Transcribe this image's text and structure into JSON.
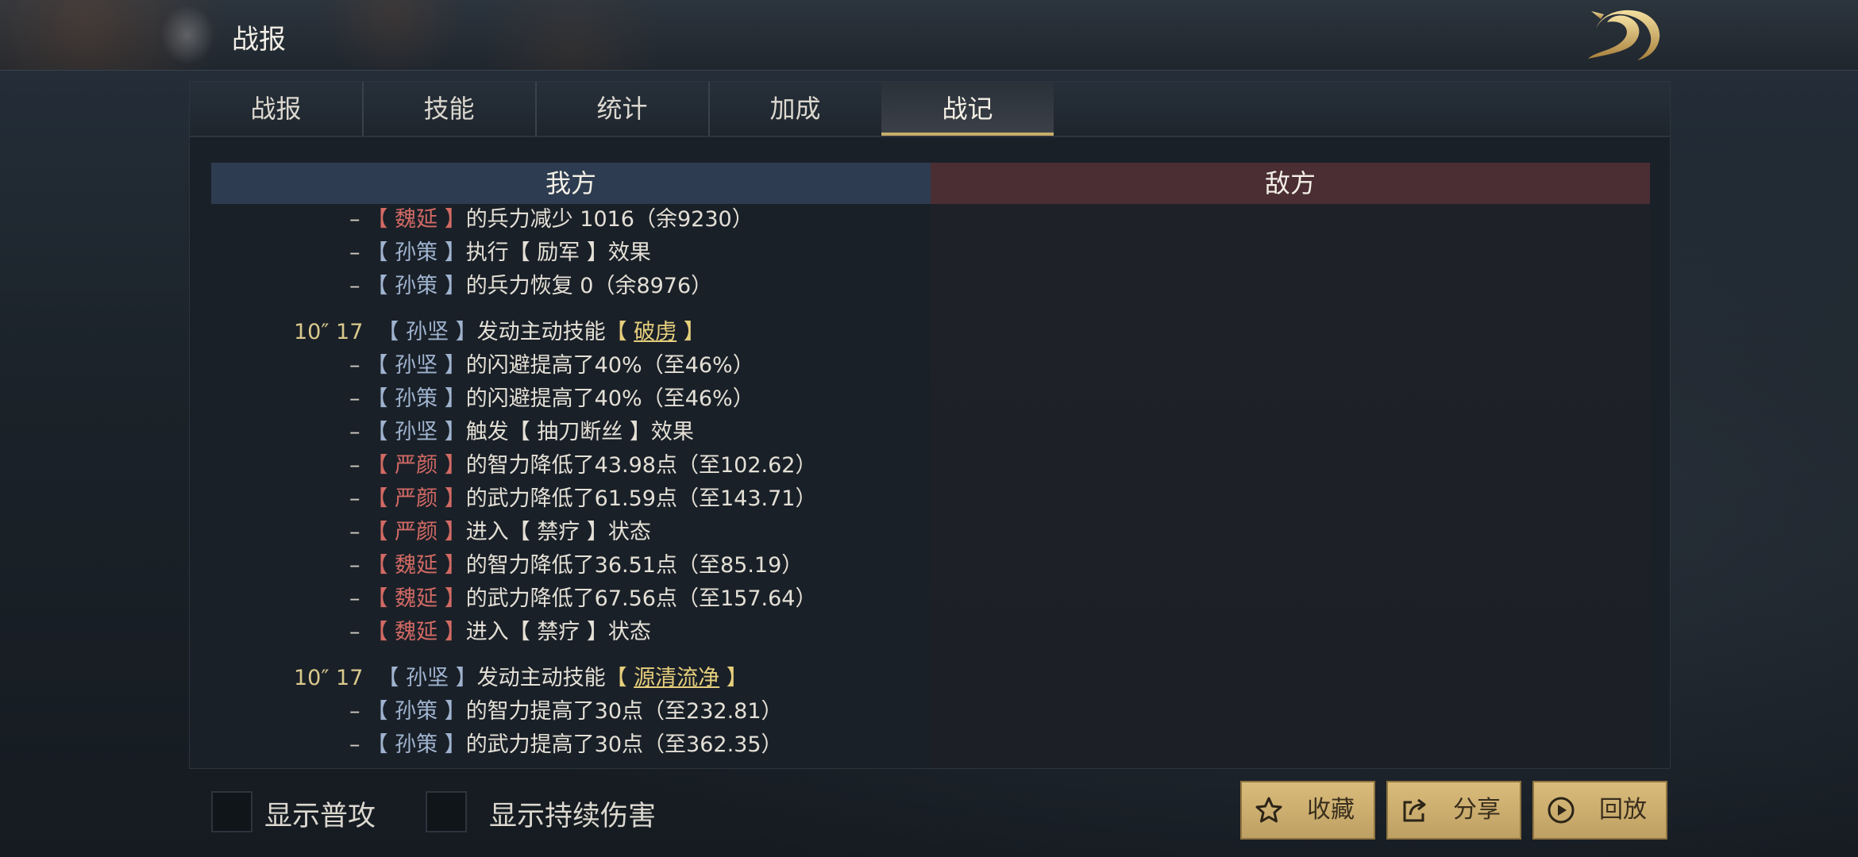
{
  "header": {
    "title": "战报"
  },
  "tabs": [
    {
      "label": "战报"
    },
    {
      "label": "技能"
    },
    {
      "label": "统计"
    },
    {
      "label": "加成"
    },
    {
      "label": "战记"
    }
  ],
  "columns": {
    "mine": "我方",
    "enemy": "敌方"
  },
  "log": [
    {
      "type": "sub",
      "parts": [
        {
          "t": "【 ",
          "c": "red"
        },
        {
          "t": "魏延",
          "c": "red"
        },
        {
          "t": " 】",
          "c": "red"
        },
        {
          "t": "的兵力减少 1016（余9230）"
        }
      ]
    },
    {
      "type": "sub",
      "parts": [
        {
          "t": "【 ",
          "c": "blue"
        },
        {
          "t": "孙策",
          "c": "blue"
        },
        {
          "t": " 】",
          "c": "blue"
        },
        {
          "t": "执行【 励军 】效果"
        }
      ]
    },
    {
      "type": "sub",
      "parts": [
        {
          "t": "【 ",
          "c": "blue"
        },
        {
          "t": "孙策",
          "c": "blue"
        },
        {
          "t": " 】",
          "c": "blue"
        },
        {
          "t": "的兵力恢复 0（余8976）"
        }
      ]
    },
    {
      "type": "hdr",
      "time": "10″ 17",
      "parts": [
        {
          "t": "【 ",
          "c": "blue"
        },
        {
          "t": "孙坚",
          "c": "blue"
        },
        {
          "t": " 】",
          "c": "blue"
        },
        {
          "t": "发动主动技能"
        },
        {
          "t": "【 ",
          "c": "skillb"
        },
        {
          "t": "破虏",
          "c": "skill"
        },
        {
          "t": " 】",
          "c": "skillb"
        }
      ]
    },
    {
      "type": "sub",
      "parts": [
        {
          "t": "【 ",
          "c": "blue"
        },
        {
          "t": "孙坚",
          "c": "blue"
        },
        {
          "t": " 】",
          "c": "blue"
        },
        {
          "t": "的闪避提高了40%（至46%）"
        }
      ]
    },
    {
      "type": "sub",
      "parts": [
        {
          "t": "【 ",
          "c": "blue"
        },
        {
          "t": "孙策",
          "c": "blue"
        },
        {
          "t": " 】",
          "c": "blue"
        },
        {
          "t": "的闪避提高了40%（至46%）"
        }
      ]
    },
    {
      "type": "sub",
      "parts": [
        {
          "t": "【 ",
          "c": "blue"
        },
        {
          "t": "孙坚",
          "c": "blue"
        },
        {
          "t": " 】",
          "c": "blue"
        },
        {
          "t": "触发【 抽刀断丝 】效果"
        }
      ]
    },
    {
      "type": "sub",
      "parts": [
        {
          "t": "【 ",
          "c": "red"
        },
        {
          "t": "严颜",
          "c": "red"
        },
        {
          "t": " 】",
          "c": "red"
        },
        {
          "t": "的智力降低了43.98点（至102.62）"
        }
      ]
    },
    {
      "type": "sub",
      "parts": [
        {
          "t": "【 ",
          "c": "red"
        },
        {
          "t": "严颜",
          "c": "red"
        },
        {
          "t": " 】",
          "c": "red"
        },
        {
          "t": "的武力降低了61.59点（至143.71）"
        }
      ]
    },
    {
      "type": "sub",
      "parts": [
        {
          "t": "【 ",
          "c": "red"
        },
        {
          "t": "严颜",
          "c": "red"
        },
        {
          "t": " 】",
          "c": "red"
        },
        {
          "t": "进入【 禁疗 】状态"
        }
      ]
    },
    {
      "type": "sub",
      "parts": [
        {
          "t": "【 ",
          "c": "red"
        },
        {
          "t": "魏延",
          "c": "red"
        },
        {
          "t": " 】",
          "c": "red"
        },
        {
          "t": "的智力降低了36.51点（至85.19）"
        }
      ]
    },
    {
      "type": "sub",
      "parts": [
        {
          "t": "【 ",
          "c": "red"
        },
        {
          "t": "魏延",
          "c": "red"
        },
        {
          "t": " 】",
          "c": "red"
        },
        {
          "t": "的武力降低了67.56点（至157.64）"
        }
      ]
    },
    {
      "type": "sub",
      "parts": [
        {
          "t": "【 ",
          "c": "red"
        },
        {
          "t": "魏延",
          "c": "red"
        },
        {
          "t": " 】",
          "c": "red"
        },
        {
          "t": "进入【 禁疗 】状态"
        }
      ]
    },
    {
      "type": "hdr",
      "time": "10″ 17",
      "parts": [
        {
          "t": "【 ",
          "c": "blue"
        },
        {
          "t": "孙坚",
          "c": "blue"
        },
        {
          "t": " 】",
          "c": "blue"
        },
        {
          "t": "发动主动技能"
        },
        {
          "t": "【 ",
          "c": "skillb"
        },
        {
          "t": "源清流净",
          "c": "skill"
        },
        {
          "t": " 】",
          "c": "skillb"
        }
      ]
    },
    {
      "type": "sub",
      "parts": [
        {
          "t": "【 ",
          "c": "blue"
        },
        {
          "t": "孙策",
          "c": "blue"
        },
        {
          "t": " 】",
          "c": "blue"
        },
        {
          "t": "的智力提高了30点（至232.81）"
        }
      ]
    },
    {
      "type": "sub",
      "parts": [
        {
          "t": "【 ",
          "c": "blue"
        },
        {
          "t": "孙策",
          "c": "blue"
        },
        {
          "t": " 】",
          "c": "blue"
        },
        {
          "t": "的武力提高了30点（至362.35）"
        }
      ]
    }
  ],
  "options": {
    "show_normal_attack": "显示普攻",
    "show_dot": "显示持续伤害"
  },
  "buttons": {
    "favorite": "收藏",
    "share": "分享",
    "replay": "回放"
  },
  "colors": {
    "accent_gold": "#c7ad6b",
    "ally_blue": "#9fb3cf",
    "enemy_red": "#d26a64",
    "skill_gold": "#e6cf7c"
  },
  "icons": {
    "logo": "dragon-logo-icon",
    "favorite": "star-icon",
    "share": "share-icon",
    "replay": "play-circle-icon"
  }
}
